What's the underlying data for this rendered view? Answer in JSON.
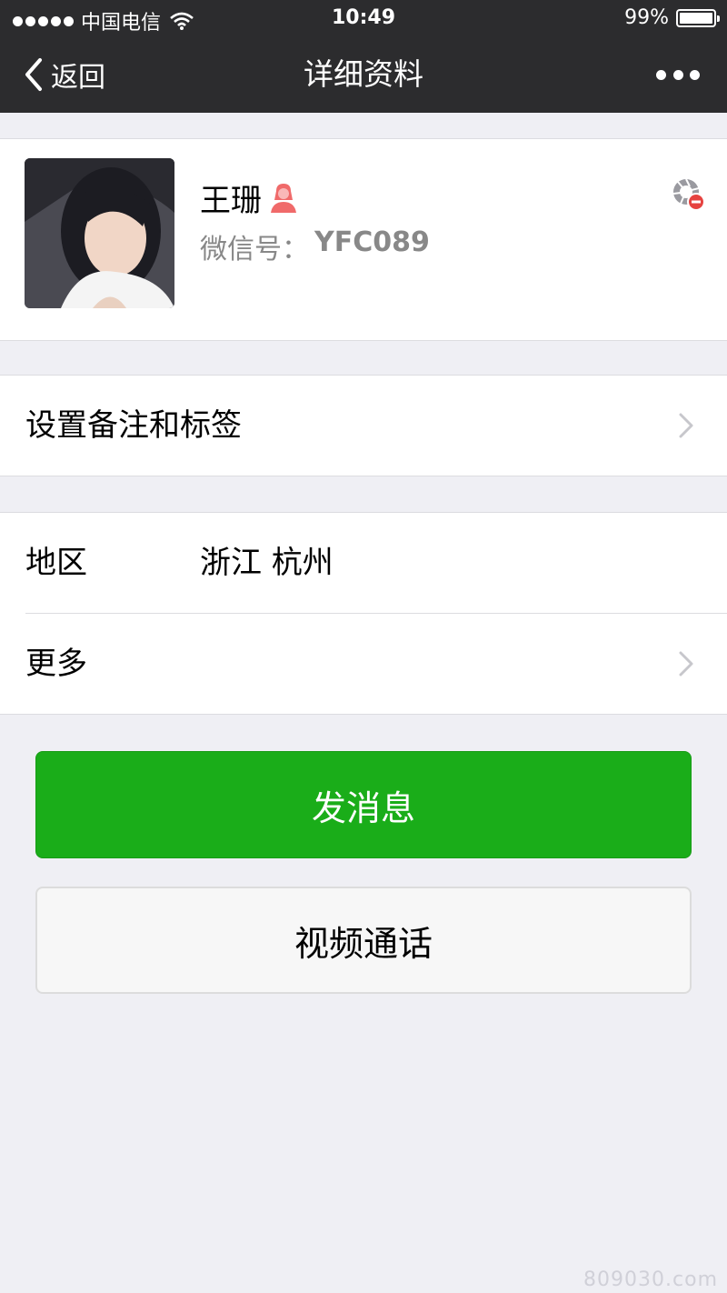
{
  "status_bar": {
    "carrier": "中国电信",
    "time": "10:49",
    "battery": "99%"
  },
  "nav": {
    "back_label": "返回",
    "title": "详细资料"
  },
  "profile": {
    "name": "王珊",
    "wechat_label": "微信号：",
    "wechat_id": "YFC089"
  },
  "cells": {
    "remark": "设置备注和标签",
    "region_label": "地区",
    "region_value": "浙江 杭州",
    "more_label": "更多"
  },
  "buttons": {
    "message": "发消息",
    "video_call": "视频通话"
  },
  "watermark": "809030.com",
  "colors": {
    "nav_bg": "#2c2c2e",
    "page_bg": "#efeff4",
    "primary_green": "#1aad19",
    "female_icon": "#f06a6a",
    "block_badge": "#e64340"
  },
  "icons": {
    "back": "chevron-left-icon",
    "more": "more-dots-icon",
    "gender": "female-user-icon",
    "block": "blocked-moments-icon",
    "disclosure": "chevron-right-icon",
    "wifi": "wifi-icon",
    "battery": "battery-icon"
  }
}
